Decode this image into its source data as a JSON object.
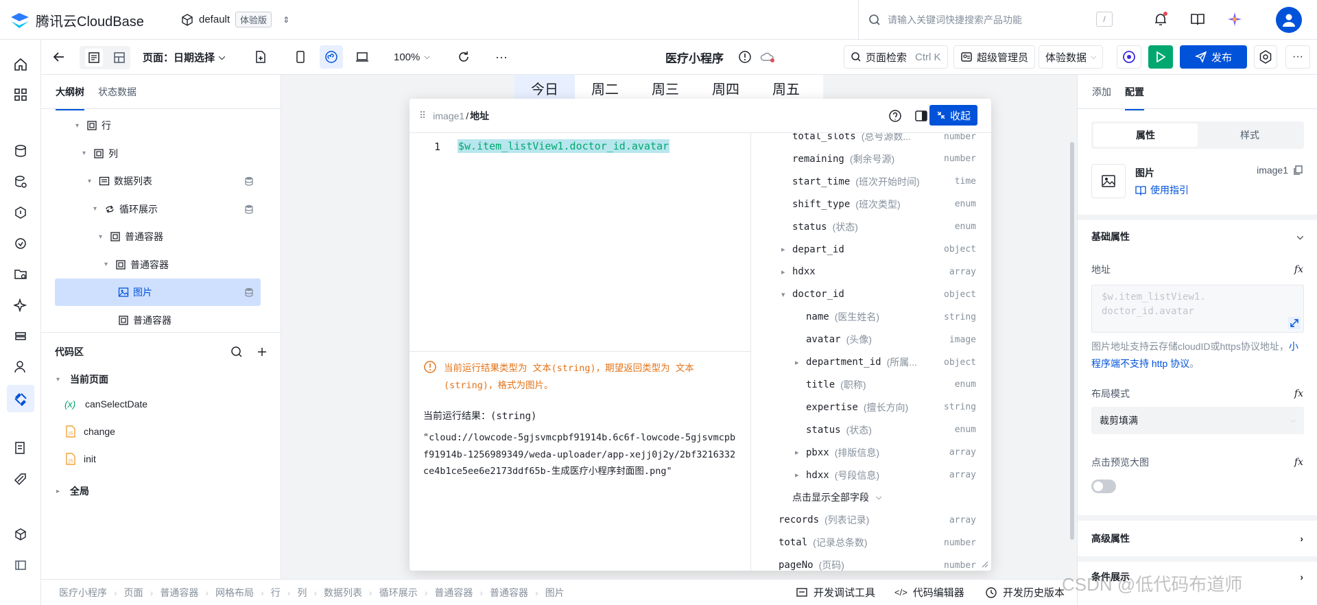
{
  "app": {
    "brand": "腾讯云CloudBase",
    "env_name": "default",
    "env_tag": "体验版"
  },
  "search": {
    "placeholder": "请输入关键词快捷搜索产品功能",
    "shortcut": "/"
  },
  "toolbar": {
    "page_label": "页面：日期选择",
    "zoom": "100%",
    "app_title": "医疗小程序",
    "page_search": "页面检索",
    "page_search_shortcut": "Ctrl K",
    "role": "超级管理员",
    "data_mode": "体验数据",
    "publish": "发布"
  },
  "left_panel": {
    "tabs": [
      "大纲树",
      "状态数据"
    ],
    "tree": [
      {
        "label": "行",
        "icon": "container-icon"
      },
      {
        "label": "列",
        "icon": "container-icon"
      },
      {
        "label": "数据列表",
        "icon": "list-icon",
        "db": true
      },
      {
        "label": "循环展示",
        "icon": "loop-icon",
        "db": true
      },
      {
        "label": "普通容器",
        "icon": "container-icon"
      },
      {
        "label": "普通容器",
        "icon": "container-icon"
      },
      {
        "label": "图片",
        "icon": "image-icon",
        "db": true,
        "selected": true
      },
      {
        "label": "普通容器",
        "icon": "container-icon"
      }
    ],
    "code_title": "代码区",
    "current_page": "当前页面",
    "code_items": [
      {
        "label": "canSelectDate",
        "icon": "variable-icon"
      },
      {
        "label": "change",
        "icon": "js-file-icon"
      },
      {
        "label": "init",
        "icon": "js-file-icon"
      }
    ],
    "global": "全局"
  },
  "canvas": {
    "date_tabs": [
      "今日",
      "周二",
      "周三",
      "周四",
      "周五"
    ]
  },
  "editor": {
    "crumb_parent": "image1",
    "crumb_current": "地址",
    "collapse_label": "收起",
    "line_number": "1",
    "code": "$w.item_listView1.doctor_id.avatar",
    "warning": "当前运行结果类型为 文本(string)，期望返回类型为 文本(string)，格式为图片。",
    "result_label": "当前运行结果：(string)",
    "result_value": "\"cloud://lowcode-5gjsvmcpbf91914b.6c6f-lowcode-5gjsvmcpbf91914b-1256989349/weda-uploader/app-xejj0j2y/2bf3216332ce4b1ce5ee6e2173ddf65b-生成医疗小程序封面图.png\"",
    "fields": [
      {
        "name": "total_slots",
        "desc": "(总号源数...",
        "type": "number",
        "indent": 1
      },
      {
        "name": "remaining",
        "desc": "(剩余号源)",
        "type": "number",
        "indent": 1
      },
      {
        "name": "start_time",
        "desc": "(班次开始时间)",
        "type": "time",
        "indent": 1
      },
      {
        "name": "shift_type",
        "desc": "(班次类型)",
        "type": "enum",
        "indent": 1
      },
      {
        "name": "status",
        "desc": "(状态)",
        "type": "enum",
        "indent": 1
      },
      {
        "name": "depart_id",
        "desc": "",
        "type": "object",
        "indent": 1,
        "arrow": "▸"
      },
      {
        "name": "hdxx",
        "desc": "",
        "type": "array",
        "indent": 1,
        "arrow": "▸"
      },
      {
        "name": "doctor_id",
        "desc": "",
        "type": "object",
        "indent": 1,
        "arrow": "▾"
      },
      {
        "name": "name",
        "desc": "(医生姓名)",
        "type": "string",
        "indent": 2
      },
      {
        "name": "avatar",
        "desc": "(头像)",
        "type": "image",
        "indent": 2
      },
      {
        "name": "department_id",
        "desc": "(所属...",
        "type": "object",
        "indent": 2,
        "arrow": "▸"
      },
      {
        "name": "title",
        "desc": "(职称)",
        "type": "enum",
        "indent": 2
      },
      {
        "name": "expertise",
        "desc": "(擅长方向)",
        "type": "string",
        "indent": 2
      },
      {
        "name": "status",
        "desc": "(状态)",
        "type": "enum",
        "indent": 2
      },
      {
        "name": "pbxx",
        "desc": "(排版信息)",
        "type": "array",
        "indent": 2,
        "arrow": "▸"
      },
      {
        "name": "hdxx",
        "desc": "(号段信息)",
        "type": "array",
        "indent": 2,
        "arrow": "▸"
      },
      {
        "name": "点击显示全部字段",
        "desc": "",
        "type": "",
        "indent": 1,
        "expand": true
      },
      {
        "name": "records",
        "desc": "(列表记录)",
        "type": "array",
        "indent": 0
      },
      {
        "name": "total",
        "desc": "(记录总条数)",
        "type": "number",
        "indent": 0
      },
      {
        "name": "pageNo",
        "desc": "(页码)",
        "type": "number",
        "indent": 0
      }
    ]
  },
  "right_panel": {
    "tabs": [
      "添加",
      "配置"
    ],
    "subtabs": [
      "属性",
      "样式"
    ],
    "component_name": "图片",
    "component_id": "image1",
    "guide_link": "使用指引",
    "basic_props": "基础属性",
    "address_label": "地址",
    "address_value": "$w.item_listView1.\ndoctor_id.avatar",
    "address_hint_a": "图片地址支持云存储cloudID或https协议地址，",
    "address_hint_link": "小程序端不支持 http 协议",
    "address_hint_b": "。",
    "layout_label": "布局模式",
    "layout_value": "裁剪填满",
    "preview_label": "点击预览大图",
    "advanced": "高级属性",
    "conditional": "条件展示",
    "fx": "fx"
  },
  "statusbar": {
    "crumbs": [
      "医疗小程序",
      "页面",
      "普通容器",
      "网格布局",
      "行",
      "列",
      "数据列表",
      "循环展示",
      "普通容器",
      "普通容器",
      "图片"
    ],
    "tools": [
      "开发调试工具",
      "代码编辑器",
      "开发历史版本"
    ]
  },
  "watermark": "CSDN @低代码布道师",
  "colors": {
    "primary": "#0052d9",
    "green": "#00a870",
    "warning": "#e37318",
    "code_highlight": "#b8e6ee"
  }
}
